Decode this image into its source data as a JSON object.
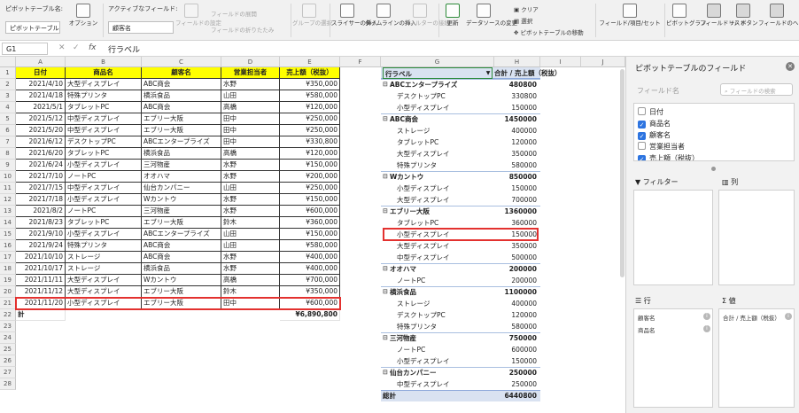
{
  "ribbon": {
    "pivot_name_label": "ピボットテーブル名:",
    "pivot_name_value": "ピボットテーブル",
    "options_label": "オプション",
    "active_field_label": "アクティブなフィールド:",
    "active_field_value": "顧客名",
    "field_settings_label": "フィールドの設定",
    "expand_field_label": "フィールドの展開",
    "collapse_field_label": "フィールドの折りたたみ",
    "group_selection_label": "グループの選択",
    "insert_slicer_label": "スライサーの挿入",
    "insert_timeline_label": "タイムラインの挿入",
    "filter_connections_label": "フィルターの接続",
    "refresh_label": "更新",
    "data_source_label": "データソースの変更",
    "clear_label": "クリア",
    "select_label": "選択",
    "move_pivot_label": "ピボットテーブルの移動",
    "fields_items_label": "フィールド/項目/セット",
    "pivot_chart_label": "ピボットグラフ",
    "field_list_label": "フィールドリスト",
    "buttons_label": "+/- ボタン",
    "field_headers_label": "フィールドのヘッダー"
  },
  "formula_bar": {
    "name_box": "G1",
    "fx": "fx",
    "value": "行ラベル"
  },
  "grid": {
    "columns": [
      "A",
      "B",
      "C",
      "D",
      "E",
      "F",
      "G",
      "H",
      "I",
      "J"
    ],
    "rows": [
      "1",
      "2",
      "3",
      "4",
      "5",
      "6",
      "7",
      "8",
      "9",
      "10",
      "11",
      "12",
      "13",
      "14",
      "15",
      "16",
      "17",
      "18",
      "19",
      "20",
      "21",
      "22",
      "23",
      "24",
      "25",
      "26",
      "27",
      "28"
    ],
    "headers": [
      "日付",
      "商品名",
      "顧客名",
      "営業担当者",
      "売上額（税抜）"
    ],
    "data": [
      [
        "2021/4/10",
        "大型ディスプレイ",
        "ABC商会",
        "水野",
        "¥350,000"
      ],
      [
        "2021/4/18",
        "特殊プリンタ",
        "横浜食品",
        "山田",
        "¥580,000"
      ],
      [
        "2021/5/1",
        "タブレットPC",
        "ABC商会",
        "高橋",
        "¥120,000"
      ],
      [
        "2021/5/12",
        "中型ディスプレイ",
        "エブリー大阪",
        "田中",
        "¥250,000"
      ],
      [
        "2021/5/20",
        "中型ディスプレイ",
        "エブリー大阪",
        "田中",
        "¥250,000"
      ],
      [
        "2021/6/12",
        "デスクトップPC",
        "ABCエンタープライズ",
        "田中",
        "¥330,800"
      ],
      [
        "2021/6/20",
        "タブレットPC",
        "横浜食品",
        "高橋",
        "¥120,000"
      ],
      [
        "2021/6/24",
        "小型ディスプレイ",
        "三河物産",
        "水野",
        "¥150,000"
      ],
      [
        "2021/7/10",
        "ノートPC",
        "オオハマ",
        "水野",
        "¥200,000"
      ],
      [
        "2021/7/15",
        "中型ディスプレイ",
        "仙台カンパニー",
        "山田",
        "¥250,000"
      ],
      [
        "2021/7/18",
        "小型ディスプレイ",
        "Wカントウ",
        "水野",
        "¥150,000"
      ],
      [
        "2021/8/2",
        "ノートPC",
        "三河物産",
        "水野",
        "¥600,000"
      ],
      [
        "2021/8/23",
        "タブレットPC",
        "エブリー大阪",
        "鈴木",
        "¥360,000"
      ],
      [
        "2021/9/10",
        "小型ディスプレイ",
        "ABCエンタープライズ",
        "山田",
        "¥150,000"
      ],
      [
        "2021/9/24",
        "特殊プリンタ",
        "ABC商会",
        "山田",
        "¥580,000"
      ],
      [
        "2021/10/10",
        "ストレージ",
        "ABC商会",
        "水野",
        "¥400,000"
      ],
      [
        "2021/10/17",
        "ストレージ",
        "横浜食品",
        "水野",
        "¥400,000"
      ],
      [
        "2021/11/11",
        "大型ディスプレイ",
        "Wカントウ",
        "高橋",
        "¥700,000"
      ],
      [
        "2021/11/12",
        "大型ディスプレイ",
        "エブリー大阪",
        "鈴木",
        "¥350,000"
      ],
      [
        "2021/11/20",
        "小型ディスプレイ",
        "エブリー大阪",
        "田中",
        "¥600,000"
      ]
    ],
    "total_label": "計",
    "total_value": "¥6,890,800"
  },
  "pivot": {
    "row_label_header": "行ラベル",
    "sum_header": "合計 / 売上額（税抜）",
    "rows": [
      {
        "label": "ABCエンタープライズ",
        "value": "480800",
        "group": true
      },
      {
        "label": "デスクトップPC",
        "value": "330800",
        "group": false
      },
      {
        "label": "小型ディスプレイ",
        "value": "150000",
        "group": false
      },
      {
        "label": "ABC商会",
        "value": "1450000",
        "group": true
      },
      {
        "label": "ストレージ",
        "value": "400000",
        "group": false
      },
      {
        "label": "タブレットPC",
        "value": "120000",
        "group": false
      },
      {
        "label": "大型ディスプレイ",
        "value": "350000",
        "group": false
      },
      {
        "label": "特殊プリンタ",
        "value": "580000",
        "group": false
      },
      {
        "label": "Wカントウ",
        "value": "850000",
        "group": true
      },
      {
        "label": "小型ディスプレイ",
        "value": "150000",
        "group": false
      },
      {
        "label": "大型ディスプレイ",
        "value": "700000",
        "group": false
      },
      {
        "label": "エブリー大阪",
        "value": "1360000",
        "group": true
      },
      {
        "label": "タブレットPC",
        "value": "360000",
        "group": false
      },
      {
        "label": "小型ディスプレイ",
        "value": "150000",
        "group": false
      },
      {
        "label": "大型ディスプレイ",
        "value": "350000",
        "group": false
      },
      {
        "label": "中型ディスプレイ",
        "value": "500000",
        "group": false
      },
      {
        "label": "オオハマ",
        "value": "200000",
        "group": true
      },
      {
        "label": "ノートPC",
        "value": "200000",
        "group": false
      },
      {
        "label": "横浜食品",
        "value": "1100000",
        "group": true
      },
      {
        "label": "ストレージ",
        "value": "400000",
        "group": false
      },
      {
        "label": "デスクトップPC",
        "value": "120000",
        "group": false
      },
      {
        "label": "特殊プリンタ",
        "value": "580000",
        "group": false
      },
      {
        "label": "三河物産",
        "value": "750000",
        "group": true
      },
      {
        "label": "ノートPC",
        "value": "600000",
        "group": false
      },
      {
        "label": "小型ディスプレイ",
        "value": "150000",
        "group": false
      },
      {
        "label": "仙台カンパニー",
        "value": "250000",
        "group": true
      },
      {
        "label": "中型ディスプレイ",
        "value": "250000",
        "group": false
      }
    ],
    "total_label": "総計",
    "total_value": "6440800"
  },
  "panel": {
    "title": "ピボットテーブルのフィールド",
    "field_name_label": "フィールド名",
    "search_placeholder": "フィールドの検索",
    "fields": [
      {
        "label": "日付",
        "checked": false
      },
      {
        "label": "商品名",
        "checked": true
      },
      {
        "label": "顧客名",
        "checked": true
      },
      {
        "label": "営業担当者",
        "checked": false
      },
      {
        "label": "売上額（税抜）",
        "checked": true
      }
    ],
    "filter_label": "フィルター",
    "columns_label": "列",
    "rows_label": "行",
    "values_label": "値",
    "row_items": [
      "顧客名",
      "商品名"
    ],
    "value_items": [
      "合計 / 売上額（税抜）"
    ]
  },
  "colors": {
    "header_yellow": "#ffff00",
    "highlight_red": "#e3312f",
    "pivot_blue": "#d9e2f1",
    "checkbox_blue": "#2d74e0"
  }
}
